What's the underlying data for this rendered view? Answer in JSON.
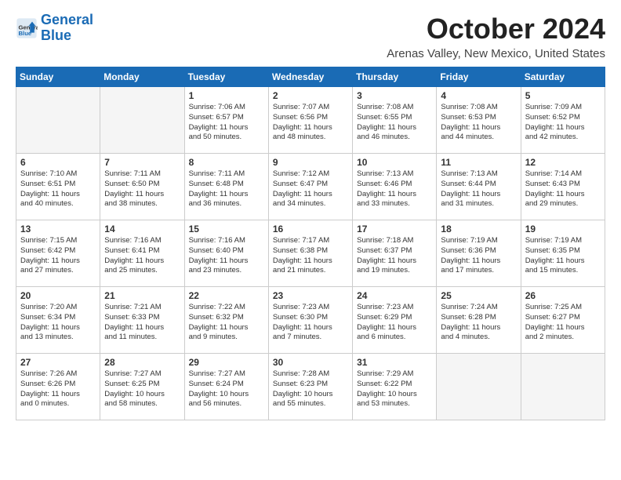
{
  "header": {
    "logo_line1": "General",
    "logo_line2": "Blue",
    "month": "October 2024",
    "location": "Arenas Valley, New Mexico, United States"
  },
  "days_of_week": [
    "Sunday",
    "Monday",
    "Tuesday",
    "Wednesday",
    "Thursday",
    "Friday",
    "Saturday"
  ],
  "weeks": [
    [
      {
        "day": "",
        "info": ""
      },
      {
        "day": "",
        "info": ""
      },
      {
        "day": "1",
        "info": "Sunrise: 7:06 AM\nSunset: 6:57 PM\nDaylight: 11 hours and 50 minutes."
      },
      {
        "day": "2",
        "info": "Sunrise: 7:07 AM\nSunset: 6:56 PM\nDaylight: 11 hours and 48 minutes."
      },
      {
        "day": "3",
        "info": "Sunrise: 7:08 AM\nSunset: 6:55 PM\nDaylight: 11 hours and 46 minutes."
      },
      {
        "day": "4",
        "info": "Sunrise: 7:08 AM\nSunset: 6:53 PM\nDaylight: 11 hours and 44 minutes."
      },
      {
        "day": "5",
        "info": "Sunrise: 7:09 AM\nSunset: 6:52 PM\nDaylight: 11 hours and 42 minutes."
      }
    ],
    [
      {
        "day": "6",
        "info": "Sunrise: 7:10 AM\nSunset: 6:51 PM\nDaylight: 11 hours and 40 minutes."
      },
      {
        "day": "7",
        "info": "Sunrise: 7:11 AM\nSunset: 6:50 PM\nDaylight: 11 hours and 38 minutes."
      },
      {
        "day": "8",
        "info": "Sunrise: 7:11 AM\nSunset: 6:48 PM\nDaylight: 11 hours and 36 minutes."
      },
      {
        "day": "9",
        "info": "Sunrise: 7:12 AM\nSunset: 6:47 PM\nDaylight: 11 hours and 34 minutes."
      },
      {
        "day": "10",
        "info": "Sunrise: 7:13 AM\nSunset: 6:46 PM\nDaylight: 11 hours and 33 minutes."
      },
      {
        "day": "11",
        "info": "Sunrise: 7:13 AM\nSunset: 6:44 PM\nDaylight: 11 hours and 31 minutes."
      },
      {
        "day": "12",
        "info": "Sunrise: 7:14 AM\nSunset: 6:43 PM\nDaylight: 11 hours and 29 minutes."
      }
    ],
    [
      {
        "day": "13",
        "info": "Sunrise: 7:15 AM\nSunset: 6:42 PM\nDaylight: 11 hours and 27 minutes."
      },
      {
        "day": "14",
        "info": "Sunrise: 7:16 AM\nSunset: 6:41 PM\nDaylight: 11 hours and 25 minutes."
      },
      {
        "day": "15",
        "info": "Sunrise: 7:16 AM\nSunset: 6:40 PM\nDaylight: 11 hours and 23 minutes."
      },
      {
        "day": "16",
        "info": "Sunrise: 7:17 AM\nSunset: 6:38 PM\nDaylight: 11 hours and 21 minutes."
      },
      {
        "day": "17",
        "info": "Sunrise: 7:18 AM\nSunset: 6:37 PM\nDaylight: 11 hours and 19 minutes."
      },
      {
        "day": "18",
        "info": "Sunrise: 7:19 AM\nSunset: 6:36 PM\nDaylight: 11 hours and 17 minutes."
      },
      {
        "day": "19",
        "info": "Sunrise: 7:19 AM\nSunset: 6:35 PM\nDaylight: 11 hours and 15 minutes."
      }
    ],
    [
      {
        "day": "20",
        "info": "Sunrise: 7:20 AM\nSunset: 6:34 PM\nDaylight: 11 hours and 13 minutes."
      },
      {
        "day": "21",
        "info": "Sunrise: 7:21 AM\nSunset: 6:33 PM\nDaylight: 11 hours and 11 minutes."
      },
      {
        "day": "22",
        "info": "Sunrise: 7:22 AM\nSunset: 6:32 PM\nDaylight: 11 hours and 9 minutes."
      },
      {
        "day": "23",
        "info": "Sunrise: 7:23 AM\nSunset: 6:30 PM\nDaylight: 11 hours and 7 minutes."
      },
      {
        "day": "24",
        "info": "Sunrise: 7:23 AM\nSunset: 6:29 PM\nDaylight: 11 hours and 6 minutes."
      },
      {
        "day": "25",
        "info": "Sunrise: 7:24 AM\nSunset: 6:28 PM\nDaylight: 11 hours and 4 minutes."
      },
      {
        "day": "26",
        "info": "Sunrise: 7:25 AM\nSunset: 6:27 PM\nDaylight: 11 hours and 2 minutes."
      }
    ],
    [
      {
        "day": "27",
        "info": "Sunrise: 7:26 AM\nSunset: 6:26 PM\nDaylight: 11 hours and 0 minutes."
      },
      {
        "day": "28",
        "info": "Sunrise: 7:27 AM\nSunset: 6:25 PM\nDaylight: 10 hours and 58 minutes."
      },
      {
        "day": "29",
        "info": "Sunrise: 7:27 AM\nSunset: 6:24 PM\nDaylight: 10 hours and 56 minutes."
      },
      {
        "day": "30",
        "info": "Sunrise: 7:28 AM\nSunset: 6:23 PM\nDaylight: 10 hours and 55 minutes."
      },
      {
        "day": "31",
        "info": "Sunrise: 7:29 AM\nSunset: 6:22 PM\nDaylight: 10 hours and 53 minutes."
      },
      {
        "day": "",
        "info": ""
      },
      {
        "day": "",
        "info": ""
      }
    ]
  ]
}
